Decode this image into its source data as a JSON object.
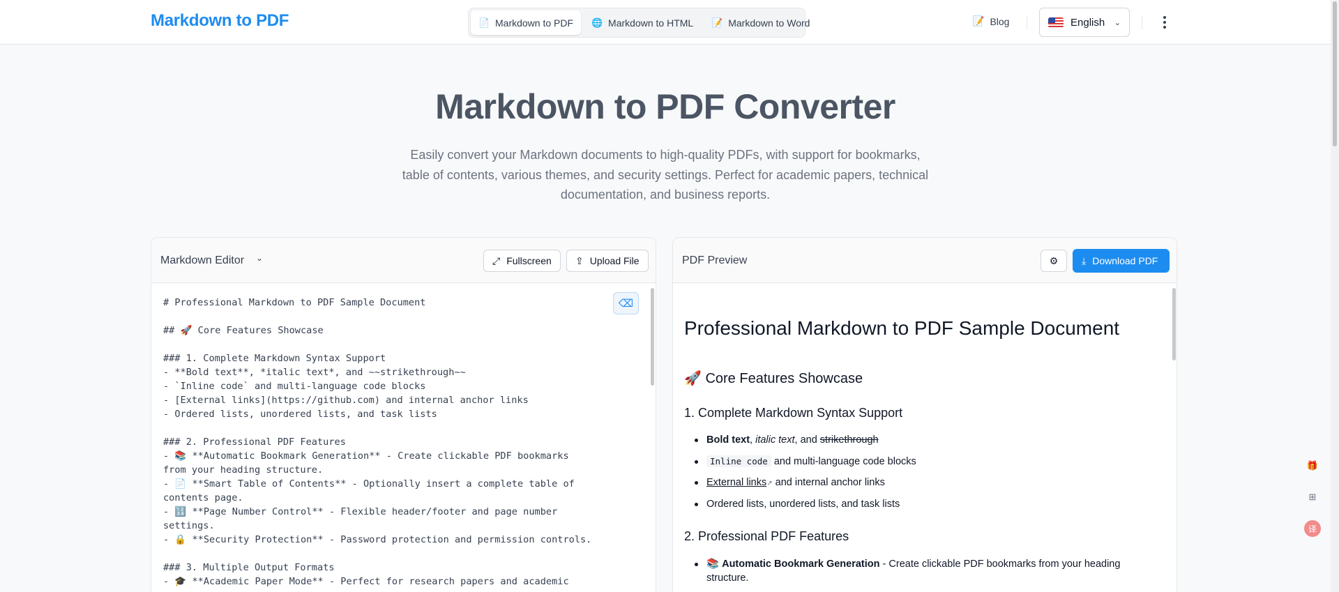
{
  "header": {
    "brand": "Markdown to PDF",
    "tabs": [
      {
        "icon": "document-icon",
        "glyph": "📄",
        "label": "Markdown to PDF"
      },
      {
        "icon": "globe-icon",
        "glyph": "🌐",
        "label": "Markdown to HTML"
      },
      {
        "icon": "memo-icon",
        "glyph": "📝",
        "label": "Markdown to Word"
      }
    ],
    "blog": {
      "glyph": "📝",
      "label": "Blog"
    },
    "language": "English"
  },
  "hero": {
    "title": "Markdown to PDF Converter",
    "subtitle": "Easily convert your Markdown documents to high-quality PDFs, with support for bookmarks, table of contents, various themes, and security settings. Perfect for academic papers, technical documentation, and business reports."
  },
  "editor": {
    "title": "Markdown Editor",
    "fullscreen_label": "Fullscreen",
    "upload_label": "Upload File",
    "lines": [
      "# Professional Markdown to PDF Sample Document",
      "",
      "## 🚀 Core Features Showcase",
      "",
      "### 1. Complete Markdown Syntax Support",
      "- **Bold text**, *italic text*, and ~~strikethrough~~",
      "- `Inline code` and multi-language code blocks",
      "- [External links](https://github.com) and internal anchor links",
      "- Ordered lists, unordered lists, and task lists",
      "",
      "### 2. Professional PDF Features",
      "- 📚 **Automatic Bookmark Generation** - Create clickable PDF bookmarks",
      "from your heading structure.",
      "- 📄 **Smart Table of Contents** - Optionally insert a complete table of",
      "contents page.",
      "- 🔢 **Page Number Control** - Flexible header/footer and page number",
      "settings.",
      "- 🔒 **Security Protection** - Password protection and permission controls.",
      "",
      "### 3. Multiple Output Formats",
      "- 🎓 **Academic Paper Mode** - Perfect for research papers and academic"
    ]
  },
  "preview": {
    "title": "PDF Preview",
    "download_label": "Download PDF",
    "h1": "Professional Markdown to PDF Sample Document",
    "h2": "🚀 Core Features Showcase",
    "section1": {
      "heading": "1. Complete Markdown Syntax Support",
      "bold": "Bold text",
      "comma": ", ",
      "italic": "italic text",
      "and": ", and ",
      "strike": "strikethrough",
      "code": "Inline code",
      "code_rest": " and multi-language code blocks",
      "link": "External links",
      "link_rest": " and internal anchor links",
      "lists": "Ordered lists, unordered lists, and task lists"
    },
    "section2": {
      "heading": "2. Professional PDF Features",
      "item_glyph": "📚",
      "item_bold": "Automatic Bookmark Generation",
      "item_rest": " - Create clickable PDF bookmarks from your heading",
      "item_cont": "structure."
    }
  },
  "floating": [
    {
      "icon": "gift-icon",
      "glyph": "🎁"
    },
    {
      "icon": "apps-icon",
      "glyph": "⊞"
    },
    {
      "icon": "translate-icon",
      "glyph": "译"
    }
  ],
  "colors": {
    "accent": "#1d8cf0",
    "hero_title": "#4b5563"
  }
}
